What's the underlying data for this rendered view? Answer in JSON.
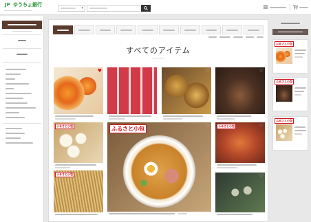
{
  "header": {
    "logo_mark": "JP",
    "logo_text": "ゆうちょ銀行"
  },
  "main": {
    "title": "すべてのアイテム",
    "selected_tab": 0
  },
  "badge_text": "ふるさと小包",
  "products": [
    {
      "favorite": true
    },
    {
      "favorite": false
    },
    {
      "favorite": false
    },
    {
      "favorite": false
    },
    {
      "favorite": false
    },
    {
      "favorite": false
    },
    {
      "favorite": false
    },
    {
      "favorite": false
    },
    {
      "favorite": false
    }
  ],
  "icons": {
    "search": "search-icon",
    "menu": "menu-icon",
    "cart": "cart-icon",
    "favorite": "heart-icon",
    "dropdown": "chevron-down-icon"
  },
  "colors": {
    "brand_green": "#2f9a3e",
    "badge_red": "#d2141e",
    "tab_active": "#5a3b2e"
  }
}
